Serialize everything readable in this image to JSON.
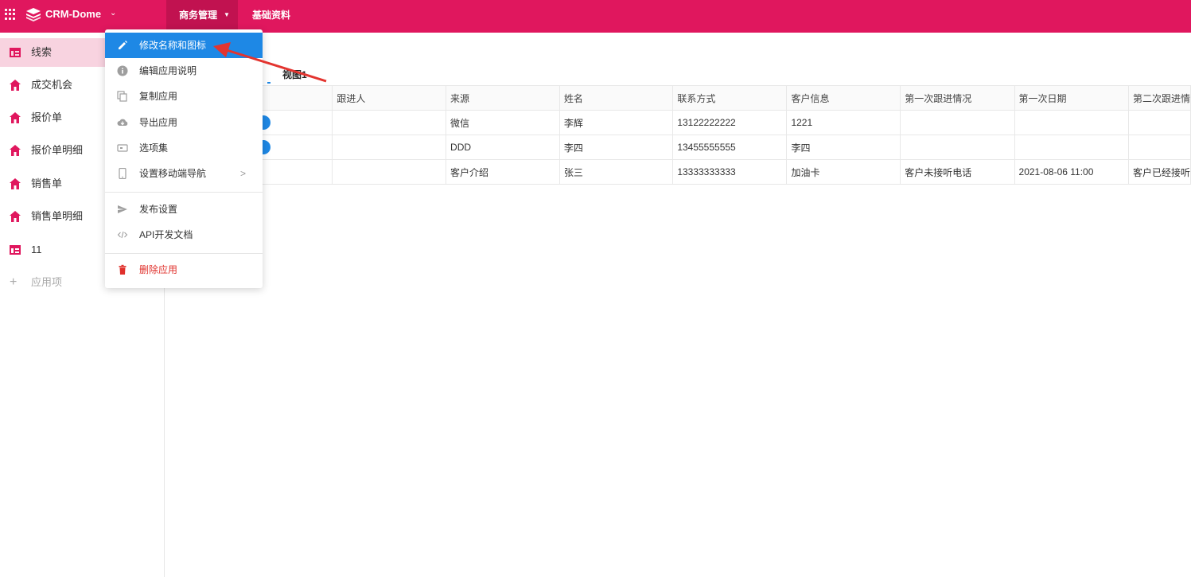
{
  "header": {
    "app_name": "CRM-Dome",
    "tabs": [
      {
        "label": "商务管理"
      },
      {
        "label": "基础资料"
      }
    ]
  },
  "sidebar": {
    "items": [
      {
        "label": "线索",
        "icon": "table-icon"
      },
      {
        "label": "成交机会",
        "icon": "home-icon"
      },
      {
        "label": "报价单",
        "icon": "home-icon"
      },
      {
        "label": "报价单明细",
        "icon": "home-icon"
      },
      {
        "label": "销售单",
        "icon": "home-icon"
      },
      {
        "label": "销售单明细",
        "icon": "home-icon"
      },
      {
        "label": "11",
        "icon": "table-icon"
      }
    ],
    "add_label": "应用项"
  },
  "view": {
    "tab_label": "视图1"
  },
  "table": {
    "columns": [
      "",
      "跟进人",
      "来源",
      "姓名",
      "联系方式",
      "客户信息",
      "第一次跟进情况",
      "第一次日期",
      "第二次跟进情"
    ],
    "rows": [
      [
        "",
        "",
        "微信",
        "李辉",
        "13122222222",
        "1221",
        "",
        "",
        ""
      ],
      [
        "",
        "",
        "DDD",
        "李四",
        "13455555555",
        "李四",
        "",
        "",
        ""
      ],
      [
        "",
        "",
        "客户介绍",
        "张三",
        "13333333333",
        "加油卡",
        "客户未接听电话",
        "2021-08-06 11:00",
        "客户已经接听"
      ]
    ]
  },
  "dropdown": {
    "items": [
      {
        "label": "修改名称和图标",
        "icon": "pencil-icon"
      },
      {
        "label": "编辑应用说明",
        "icon": "info-icon"
      },
      {
        "label": "复制应用",
        "icon": "copy-icon"
      },
      {
        "label": "导出应用",
        "icon": "cloud-download-icon"
      },
      {
        "label": "选项集",
        "icon": "options-icon"
      },
      {
        "label": "设置移动端导航",
        "icon": "mobile-icon"
      },
      {
        "label": "发布设置",
        "icon": "send-icon"
      },
      {
        "label": "API开发文档",
        "icon": "code-icon"
      },
      {
        "label": "删除应用",
        "icon": "trash-icon"
      }
    ]
  },
  "colors": {
    "brand": "#e0175e",
    "brand_dark": "#c11250",
    "accent": "#1e88e5",
    "danger": "#e0302b",
    "arrow": "#e3342f"
  }
}
